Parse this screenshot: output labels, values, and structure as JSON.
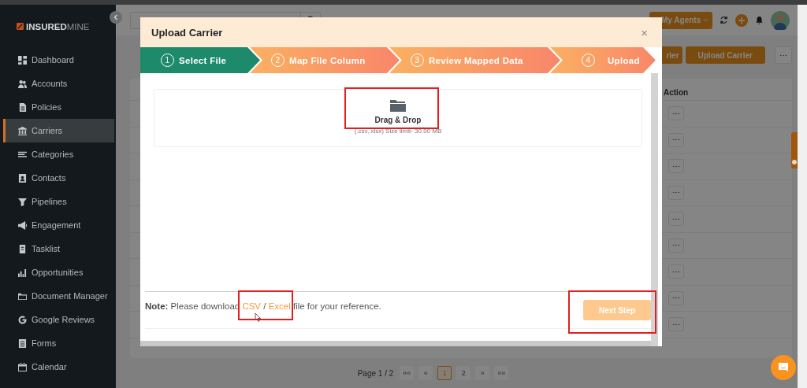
{
  "sidebar": {
    "logo": "**INSURED**MINE",
    "items": [
      {
        "label": "Dashboard",
        "selected": false
      },
      {
        "label": "Accounts",
        "selected": false
      },
      {
        "label": "Policies",
        "selected": false
      },
      {
        "label": "Carriers",
        "selected": true
      },
      {
        "label": "Categories",
        "selected": false
      },
      {
        "label": "Contacts",
        "selected": false
      },
      {
        "label": "Pipelines",
        "selected": false
      },
      {
        "label": "Engagement",
        "selected": false
      },
      {
        "label": "Tasklist",
        "selected": false
      },
      {
        "label": "Opportunities",
        "selected": false
      },
      {
        "label": "Document Manager",
        "selected": false
      },
      {
        "label": "Google Reviews",
        "selected": false
      },
      {
        "label": "Forms",
        "selected": false
      },
      {
        "label": "Calendar",
        "selected": false
      }
    ]
  },
  "header": {
    "agents_button": "My Agents"
  },
  "toolbar": {
    "partial_button": "rier",
    "upload_button": "Upload Carrier"
  },
  "table": {
    "columns": [
      {
        "label": "Action"
      }
    ],
    "rows": [
      {
        "kind": "more-button"
      },
      {
        "kind": "more-button"
      },
      {
        "kind": "more-button"
      },
      {
        "kind": "more-button"
      },
      {
        "kind": "more-button"
      },
      {
        "kind": "more-button"
      },
      {
        "kind": "more-button"
      },
      {
        "kind": "more-button"
      },
      {
        "kind": "more-button"
      }
    ]
  },
  "pagination": {
    "label": "Page 1 / 2",
    "buttons": [
      {
        "label": "««",
        "selected": false
      },
      {
        "label": "«",
        "selected": false
      },
      {
        "label": "1",
        "selected": true
      },
      {
        "label": "2",
        "selected": false
      },
      {
        "label": "»",
        "selected": false
      },
      {
        "label": "»»",
        "selected": false
      }
    ]
  },
  "modal": {
    "title": "Upload Carrier",
    "close": "×",
    "steps": [
      {
        "number": "1",
        "label": "Select File",
        "selected": true
      },
      {
        "number": "2",
        "label": "Map File Column",
        "selected": false
      },
      {
        "number": "3",
        "label": "Review Mapped Data",
        "selected": false
      },
      {
        "number": "4",
        "label": "Upload",
        "selected": false
      }
    ],
    "dropzone": {
      "title": "Drag & Drop",
      "hint": "(.csv,.xlsx) Size limit- 30.00 MB"
    },
    "note": {
      "label": "Note:",
      "text": "Please download",
      "links": [
        "CSV",
        "Excel"
      ],
      "separator": "/",
      "suffix": "file for your reference."
    },
    "next_button": {
      "label": "Next Step",
      "disabled": true
    }
  }
}
